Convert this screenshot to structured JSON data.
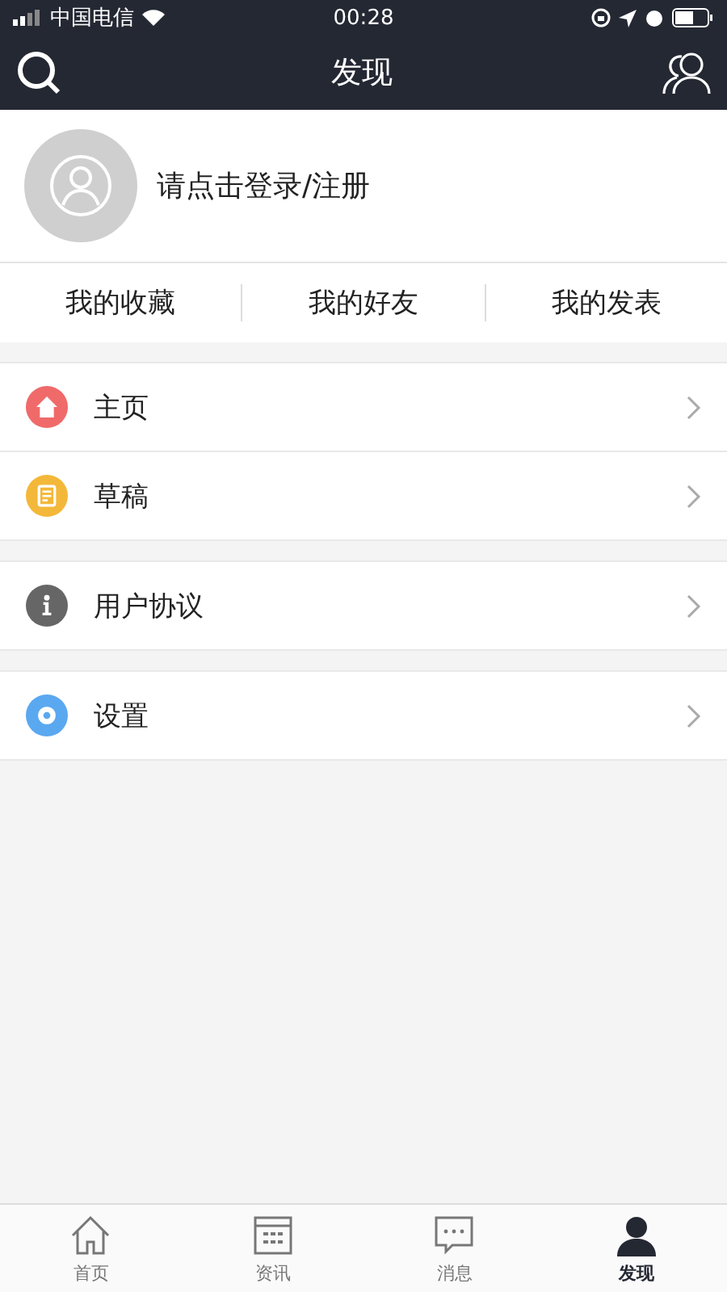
{
  "status_bar": {
    "carrier": "中国电信",
    "time": "00:28"
  },
  "header": {
    "title": "发现"
  },
  "profile": {
    "prompt": "请点击登录/注册"
  },
  "links": [
    "我的收藏",
    "我的好友",
    "我的发表"
  ],
  "menu_groups": [
    {
      "items": [
        {
          "kind": "home",
          "label": "主页"
        },
        {
          "kind": "draft",
          "label": "草稿"
        }
      ]
    },
    {
      "items": [
        {
          "kind": "info",
          "label": "用户协议"
        }
      ]
    },
    {
      "items": [
        {
          "kind": "settings",
          "label": "设置"
        }
      ]
    }
  ],
  "tab_bar": [
    {
      "kind": "home",
      "label": "首页",
      "selected": false
    },
    {
      "kind": "news",
      "label": "资讯",
      "selected": false
    },
    {
      "kind": "message",
      "label": "消息",
      "selected": false
    },
    {
      "kind": "discover",
      "label": "发现",
      "selected": true
    }
  ]
}
